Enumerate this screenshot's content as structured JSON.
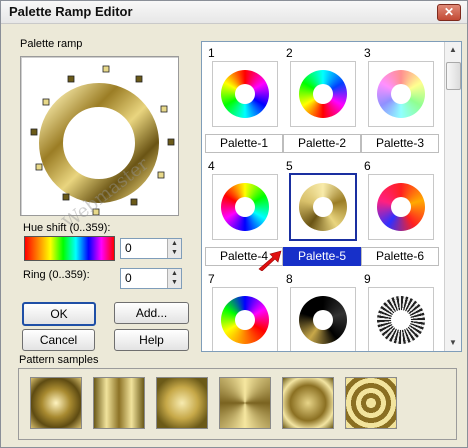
{
  "window": {
    "title": "Palette Ramp Editor",
    "close_glyph": "✕"
  },
  "ramp": {
    "label": "Palette ramp",
    "hue_label": "Hue shift (0..359):",
    "hue_value": "0",
    "ring_label": "Ring (0..359):",
    "ring_value": "0"
  },
  "buttons": {
    "ok": "OK",
    "add": "Add...",
    "cancel": "Cancel",
    "help": "Help"
  },
  "palettes": [
    {
      "number": "1",
      "name": "Palette-1",
      "style": "rainbow"
    },
    {
      "number": "2",
      "name": "Palette-2",
      "style": "rainbow2"
    },
    {
      "number": "3",
      "name": "Palette-3",
      "style": "pastel"
    },
    {
      "number": "4",
      "name": "Palette-4",
      "style": "rainbow3"
    },
    {
      "number": "5",
      "name": "Palette-5",
      "style": "gold",
      "selected": true
    },
    {
      "number": "6",
      "name": "Palette-6",
      "style": "redblue"
    },
    {
      "number": "7",
      "name": "",
      "style": "rainbow4"
    },
    {
      "number": "8",
      "name": "",
      "style": "blackgold"
    },
    {
      "number": "9",
      "name": "",
      "style": "stripes"
    }
  ],
  "samples_label": "Pattern samples",
  "sample_count": 6,
  "watermark": "Webmaster",
  "colors": {
    "selection": "#1730c9",
    "gold_dark": "#6b5a18",
    "gold_light": "#f4e7a0"
  }
}
